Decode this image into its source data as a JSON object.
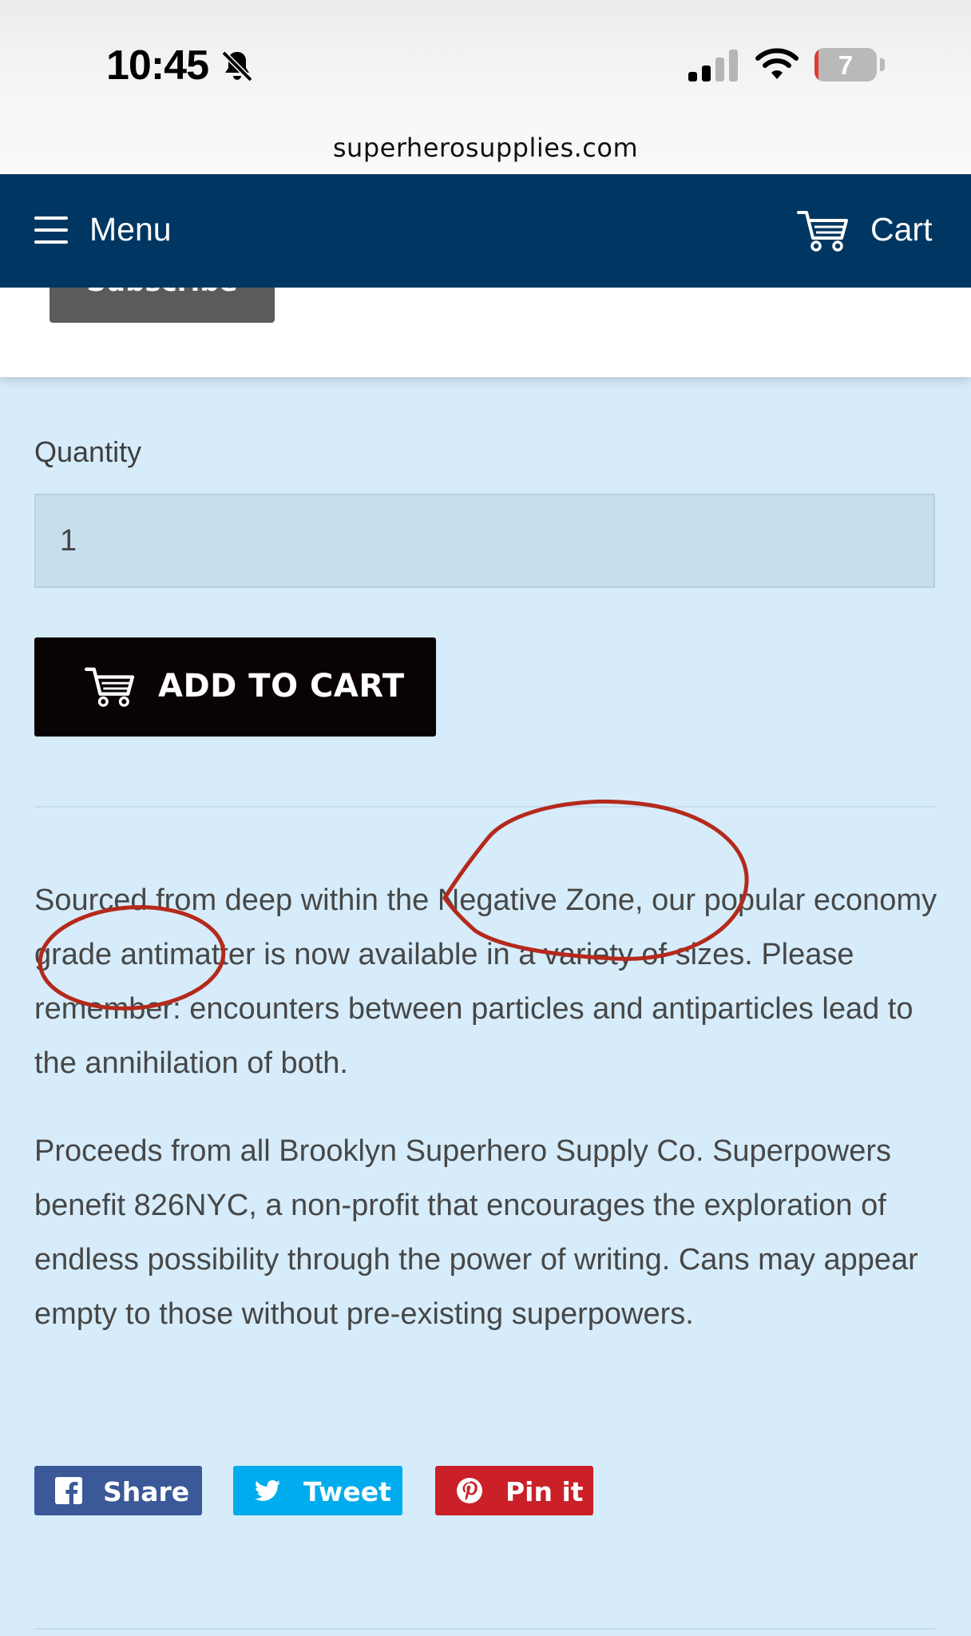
{
  "status_bar": {
    "time": "10:45",
    "battery_level": "7",
    "battery_fraction": 0.07
  },
  "browser": {
    "url": "superherosupplies.com"
  },
  "navbar": {
    "menu_label": "Menu",
    "cart_label": "Cart",
    "background_color": "#003762"
  },
  "subscribe": {
    "label": "Subscribe"
  },
  "product": {
    "quantity_label": "Quantity",
    "quantity_value": "1",
    "add_to_cart_label": "ADD TO CART",
    "description_paragraphs": [
      "Sourced from deep within the Negative Zone, our popular economy grade antimatter is now available in a variety of sizes. Please remember: encounters between particles and antiparticles lead to the annihilation of both.",
      "Proceeds from all Brooklyn Superhero Supply Co. Superpowers benefit 826NYC, a non-profit that encourages the exploration of endless possibility through the power of writing. Cans may appear empty to those without pre-existing superpowers."
    ]
  },
  "share": {
    "facebook_label": "Share",
    "twitter_label": "Tweet",
    "pinterest_label": "Pin it",
    "colors": {
      "facebook": "#3b5998",
      "twitter": "#00aced",
      "pinterest": "#cb2027"
    }
  },
  "annotation_color": "#b5291c"
}
